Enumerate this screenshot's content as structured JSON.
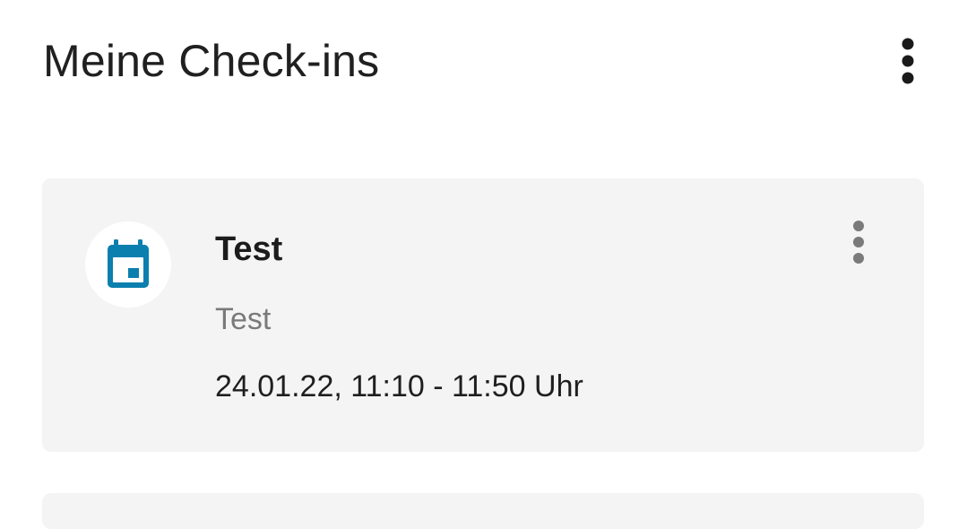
{
  "header": {
    "title": "Meine Check-ins",
    "menu_icon": "more-vert-icon"
  },
  "checkins": [
    {
      "icon": "calendar-icon",
      "icon_color": "#0b7fae",
      "title": "Test",
      "subtitle": "Test",
      "time": "24.01.22, 11:10 - 11:50 Uhr",
      "menu_icon": "more-vert-icon"
    }
  ],
  "colors": {
    "card_background": "#f4f4f4",
    "accent": "#0b7fae"
  }
}
